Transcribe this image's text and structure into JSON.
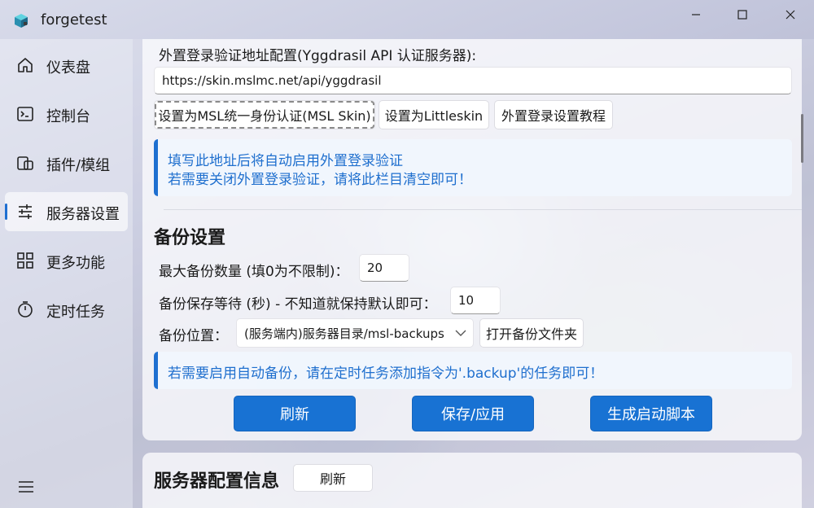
{
  "window": {
    "title": "forgetest",
    "controls": {
      "minimize": "minimize-icon",
      "maximize": "maximize-icon",
      "close": "close-icon"
    }
  },
  "sidebar": {
    "items": [
      {
        "label": "仪表盘",
        "icon": "home-icon"
      },
      {
        "label": "控制台",
        "icon": "console-icon"
      },
      {
        "label": "插件/模组",
        "icon": "plugins-icon"
      },
      {
        "label": "服务器设置",
        "icon": "sliders-icon",
        "active": true
      },
      {
        "label": "更多功能",
        "icon": "grid-icon"
      },
      {
        "label": "定时任务",
        "icon": "timer-icon"
      }
    ],
    "menu_icon": "hamburger-icon"
  },
  "auth": {
    "label": "外置登录验证地址配置(Yggdrasil API 认证服务器):",
    "url_value": "https://skin.mslmc.net/api/yggdrasil",
    "buttons": {
      "msl_skin": "设置为MSL统一身份认证(MSL Skin)",
      "littleskin": "设置为Littleskin",
      "tutorial": "外置登录设置教程"
    },
    "info": {
      "line1": "填写此地址后将自动启用外置登录验证",
      "line2": "若需要关闭外置登录验证，请将此栏目清空即可！"
    }
  },
  "backup": {
    "title": "备份设置",
    "max_count_label": "最大备份数量 (填0为不限制)：",
    "max_count_value": "20",
    "wait_label": "备份保存等待 (秒) - 不知道就保持默认即可：",
    "wait_value": "10",
    "location_label": "备份位置：",
    "location_value": "(服务端内)服务器目录/msl-backups",
    "open_folder_button": "打开备份文件夹",
    "info": "若需要启用自动备份，请在定时任务添加指令为'.backup'的任务即可！"
  },
  "actions": {
    "refresh": "刷新",
    "save": "保存/应用",
    "generate_script": "生成启动脚本"
  },
  "server_info": {
    "title": "服务器配置信息",
    "refresh": "刷新"
  },
  "colors": {
    "accent": "#1872d3",
    "info_text": "#1f6fce",
    "info_bg": "#f0f6fd"
  }
}
